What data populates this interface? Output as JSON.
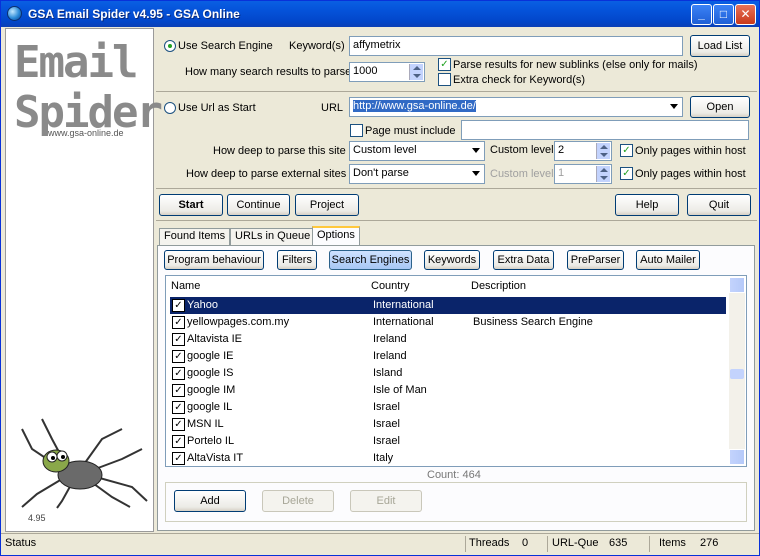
{
  "window": {
    "title": "GSA Email Spider v4.95 - GSA Online",
    "min": "_",
    "max": "□",
    "close": "✕"
  },
  "brand": {
    "line1": "Email",
    "line2": "Spider",
    "url": "www.gsa-online.de",
    "version": "4.95"
  },
  "search_engine": {
    "radio_label": "Use Search Engine",
    "keywords_label": "Keyword(s)",
    "keywords_value": "affymetrix",
    "load_list": "Load List",
    "results_label": "How many search results to parse",
    "results_value": "1000",
    "parse_sublinks": "Parse results for new sublinks (else only for mails)",
    "extra_check": "Extra check for Keyword(s)"
  },
  "url_start": {
    "radio_label": "Use Url as Start",
    "url_label": "URL",
    "url_value": "http://www.gsa-online.de/",
    "open": "Open",
    "page_must_include": "Page must include",
    "deep_site_label": "How deep to parse this site",
    "deep_site_value": "Custom level",
    "custom_level_label": "Custom level",
    "custom_level_value": "2",
    "only_within_host": "Only pages within host",
    "deep_ext_label": "How deep to parse external sites",
    "deep_ext_value": "Don't parse",
    "custom_level2_label": "Custom level",
    "custom_level2_value": "1",
    "only_within_host2": "Only pages within host"
  },
  "actions": {
    "start": "Start",
    "continue": "Continue",
    "project": "Project",
    "help": "Help",
    "quit": "Quit"
  },
  "tabs": [
    "Found Items",
    "URLs in Queue",
    "Options"
  ],
  "subtabs": [
    "Program behaviour",
    "Filters",
    "Search Engines",
    "Keywords",
    "Extra Data",
    "PreParser",
    "Auto Mailer"
  ],
  "list": {
    "headers": [
      "Name",
      "Country",
      "Description"
    ],
    "rows": [
      {
        "name": "Yahoo",
        "country": "International",
        "desc": ""
      },
      {
        "name": "yellowpages.com.my",
        "country": "International",
        "desc": "Business Search Engine"
      },
      {
        "name": "Altavista IE",
        "country": "Ireland",
        "desc": ""
      },
      {
        "name": "google IE",
        "country": "Ireland",
        "desc": ""
      },
      {
        "name": "google IS",
        "country": "Island",
        "desc": ""
      },
      {
        "name": "google IM",
        "country": "Isle of Man",
        "desc": ""
      },
      {
        "name": "google IL",
        "country": "Israel",
        "desc": ""
      },
      {
        "name": "MSN IL",
        "country": "Israel",
        "desc": ""
      },
      {
        "name": "Portelo IL",
        "country": "Israel",
        "desc": ""
      },
      {
        "name": "AltaVista IT",
        "country": "Italy",
        "desc": ""
      }
    ],
    "count": "Count: 464"
  },
  "list_buttons": {
    "add": "Add",
    "delete": "Delete",
    "edit": "Edit"
  },
  "status": {
    "label": "Status",
    "threads_label": "Threads",
    "threads": "0",
    "urlque_label": "URL-Que",
    "urlque": "635",
    "items_label": "Items",
    "items": "276"
  }
}
